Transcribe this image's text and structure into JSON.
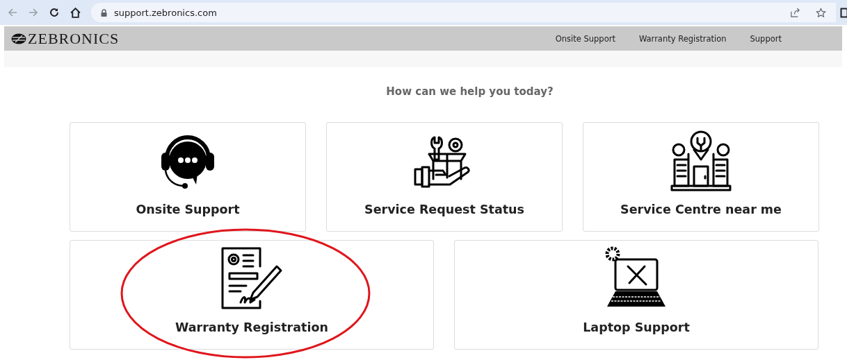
{
  "browser": {
    "url": "support.zebronics.com"
  },
  "header": {
    "logo": "ZEBRONICS",
    "nav": [
      "Onsite Support",
      "Warranty Registration",
      "Support"
    ]
  },
  "heading": "How can we help you today?",
  "cards": [
    {
      "title": "Onsite Support",
      "kind": "headset",
      "circled": false
    },
    {
      "title": "Service Request Status",
      "kind": "box",
      "circled": false
    },
    {
      "title": "Service Centre near me",
      "kind": "building",
      "circled": false
    },
    {
      "title": "Warranty Registration",
      "kind": "document",
      "circled": true
    },
    {
      "title": "Laptop Support",
      "kind": "laptop",
      "circled": false
    }
  ]
}
